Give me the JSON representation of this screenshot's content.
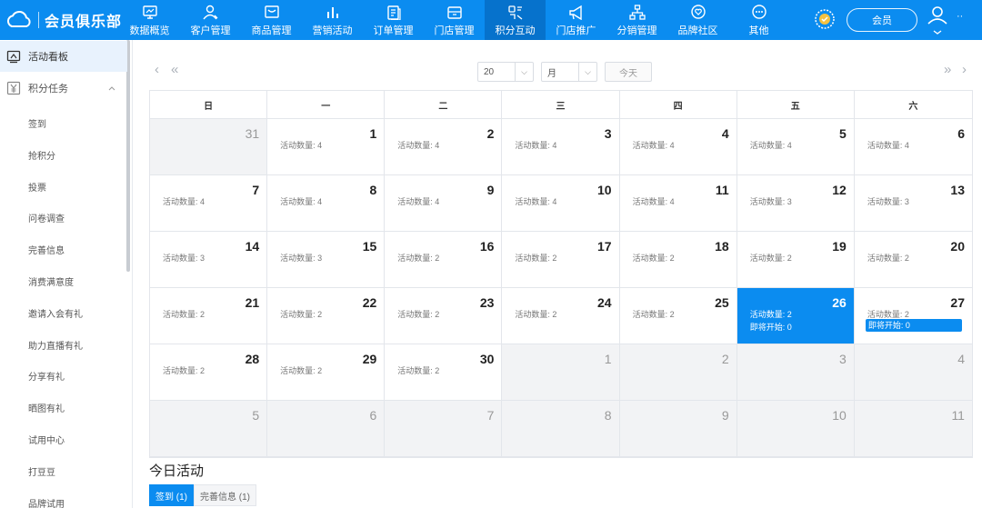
{
  "header": {
    "app_title": "会员俱乐部",
    "nav": [
      {
        "label": "数据概览",
        "icon": "monitor-icon"
      },
      {
        "label": "客户管理",
        "icon": "user-icon"
      },
      {
        "label": "商品管理",
        "icon": "box-icon"
      },
      {
        "label": "营销活动",
        "icon": "bar-chart-icon"
      },
      {
        "label": "订单管理",
        "icon": "clipboard-icon"
      },
      {
        "label": "门店管理",
        "icon": "store-icon"
      },
      {
        "label": "积分互动",
        "icon": "points-icon",
        "active": true
      },
      {
        "label": "门店推广",
        "icon": "megaphone-icon"
      },
      {
        "label": "分销管理",
        "icon": "network-icon"
      },
      {
        "label": "品牌社区",
        "icon": "heart-bubble-icon"
      },
      {
        "label": "其他",
        "icon": "more-icon"
      }
    ],
    "store_pill": "会员",
    "user_name": "··"
  },
  "sidebar": {
    "top_item": "活动看板",
    "group_label": "积分任务",
    "sub_items": [
      "签到",
      "抢积分",
      "投票",
      "问卷调查",
      "完善信息",
      "消费满意度",
      "邀请入会有礼",
      "助力直播有礼",
      "分享有礼",
      "晒图有礼",
      "试用中心",
      "打豆豆",
      "品牌试用"
    ]
  },
  "calendar_toolbar": {
    "year_value": "20",
    "month_value": "月",
    "today_label": "今天"
  },
  "calendar": {
    "weekdays": [
      "日",
      "一",
      "二",
      "三",
      "四",
      "五",
      "六"
    ],
    "count_prefix": "活动数量: ",
    "soon_prefix": "即将开始: ",
    "cells": [
      {
        "day": "31",
        "other": true
      },
      {
        "day": "1",
        "count": "活动数量: 4"
      },
      {
        "day": "2",
        "count": "活动数量: 4"
      },
      {
        "day": "3",
        "count": "活动数量: 4"
      },
      {
        "day": "4",
        "count": "活动数量: 4"
      },
      {
        "day": "5",
        "count": "活动数量: 4"
      },
      {
        "day": "6",
        "count": "活动数量: 4"
      },
      {
        "day": "7",
        "count": "活动数量: 4"
      },
      {
        "day": "8",
        "count": "活动数量: 4"
      },
      {
        "day": "9",
        "count": "活动数量: 4"
      },
      {
        "day": "10",
        "count": "活动数量: 4"
      },
      {
        "day": "11",
        "count": "活动数量: 4"
      },
      {
        "day": "12",
        "count": "活动数量: 3"
      },
      {
        "day": "13",
        "count": "活动数量: 3"
      },
      {
        "day": "14",
        "count": "活动数量: 3"
      },
      {
        "day": "15",
        "count": "活动数量: 3"
      },
      {
        "day": "16",
        "count": "活动数量: 2"
      },
      {
        "day": "17",
        "count": "活动数量: 2"
      },
      {
        "day": "18",
        "count": "活动数量: 2"
      },
      {
        "day": "19",
        "count": "活动数量: 2"
      },
      {
        "day": "20",
        "count": "活动数量: 2"
      },
      {
        "day": "21",
        "count": "活动数量: 2"
      },
      {
        "day": "22",
        "count": "活动数量: 2"
      },
      {
        "day": "23",
        "count": "活动数量: 2"
      },
      {
        "day": "24",
        "count": "活动数量: 2"
      },
      {
        "day": "25",
        "count": "活动数量: 2"
      },
      {
        "day": "26",
        "count": "活动数量: 2",
        "soon": "即将开始: 0",
        "today": true
      },
      {
        "day": "27",
        "count": "活动数量: 2",
        "soon": "即将开始: 0",
        "soon_tag": true
      },
      {
        "day": "28",
        "count": "活动数量: 2"
      },
      {
        "day": "29",
        "count": "活动数量: 2"
      },
      {
        "day": "30",
        "count": "活动数量: 2"
      },
      {
        "day": "1",
        "other": true
      },
      {
        "day": "2",
        "other": true
      },
      {
        "day": "3",
        "other": true
      },
      {
        "day": "4",
        "other": true
      },
      {
        "day": "5",
        "other": true
      },
      {
        "day": "6",
        "other": true
      },
      {
        "day": "7",
        "other": true
      },
      {
        "day": "8",
        "other": true
      },
      {
        "day": "9",
        "other": true
      },
      {
        "day": "10",
        "other": true
      },
      {
        "day": "11",
        "other": true
      }
    ]
  },
  "today_section": {
    "title": "今日活动",
    "tabs": [
      {
        "label": "签到 (1)",
        "active": true
      },
      {
        "label": "完善信息 (1)"
      }
    ]
  },
  "colors": {
    "primary": "#0b8cf0",
    "nav_active": "#0672cc",
    "sidebar_active": "#e8f2fd"
  }
}
